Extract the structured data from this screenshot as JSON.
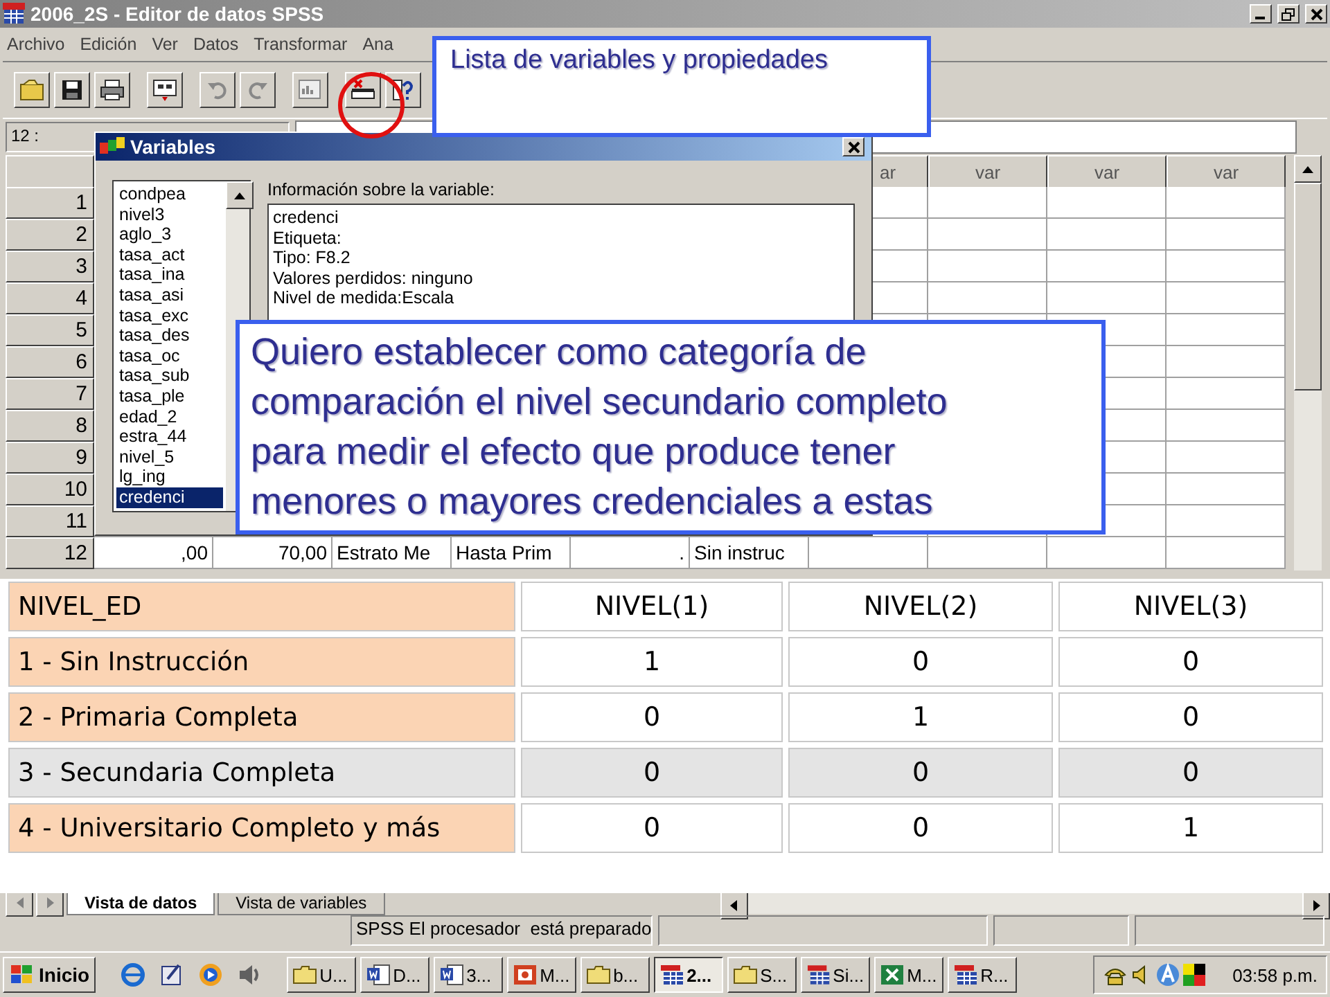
{
  "window": {
    "title": "2006_2S - Editor de datos SPSS"
  },
  "menu": [
    "Archivo",
    "Edición",
    "Ver",
    "Datos",
    "Transformar",
    "Ana"
  ],
  "cell_ref": {
    "label": "12 :"
  },
  "grid": {
    "column_headers": [
      "ar",
      "var",
      "var",
      "var"
    ],
    "rows": [
      {
        "number": "1"
      },
      {
        "number": "2"
      },
      {
        "number": "3"
      },
      {
        "number": "4"
      },
      {
        "number": "5"
      },
      {
        "number": "6"
      },
      {
        "number": "7"
      },
      {
        "number": "8"
      },
      {
        "number": "9"
      },
      {
        "number": "10"
      },
      {
        "number": "11"
      },
      {
        "number": "12",
        "cells": [
          ",00",
          "70,00",
          "Estrato Me",
          "Hasta Prim",
          ".",
          "Sin instruc"
        ]
      }
    ]
  },
  "dialog": {
    "title": "Variables",
    "info_label": "Información sobre la variable:",
    "variables": [
      {
        "name": "condpea",
        "selected": false
      },
      {
        "name": "nivel3",
        "selected": false
      },
      {
        "name": "aglo_3",
        "selected": false
      },
      {
        "name": "tasa_act",
        "selected": false
      },
      {
        "name": "tasa_ina",
        "selected": false
      },
      {
        "name": "tasa_asi",
        "selected": false
      },
      {
        "name": "tasa_exc",
        "selected": false
      },
      {
        "name": "tasa_des",
        "selected": false
      },
      {
        "name": "tasa_oc",
        "selected": false
      },
      {
        "name": "tasa_sub",
        "selected": false
      },
      {
        "name": "tasa_ple",
        "selected": false
      },
      {
        "name": "edad_2",
        "selected": false
      },
      {
        "name": "estra_44",
        "selected": false
      },
      {
        "name": "nivel_5",
        "selected": false
      },
      {
        "name": "lg_ing",
        "selected": false
      },
      {
        "name": "credenci",
        "selected": true
      }
    ],
    "info_lines": [
      "credenci",
      "Etiqueta:",
      "Tipo: F8.2",
      "Valores perdidos: ninguno",
      "Nivel de medida:Escala"
    ]
  },
  "callout_top": {
    "text": "Lista de variables y propiedades"
  },
  "callout_main": {
    "lines": [
      "Quiero establecer como categoría de",
      "comparación el nivel secundario completo",
      "para medir el efecto que produce tener",
      "menores o mayores credenciales a estas"
    ]
  },
  "coding_table": {
    "header": [
      "NIVEL_ED",
      "NIVEL(1)",
      "NIVEL(2)",
      "NIVEL(3)"
    ],
    "rows": [
      {
        "label": "1 - Sin Instrucción",
        "values": [
          "1",
          "0",
          "0"
        ],
        "highlighted": false
      },
      {
        "label": "2 - Primaria Completa",
        "values": [
          "0",
          "1",
          "0"
        ],
        "highlighted": false
      },
      {
        "label": "3 - Secundaria Completa",
        "values": [
          "0",
          "0",
          "0"
        ],
        "highlighted": true
      },
      {
        "label": "4 - Universitario Completo y más",
        "values": [
          "0",
          "0",
          "1"
        ],
        "highlighted": false
      }
    ]
  },
  "sheet_tabs": [
    {
      "label": "Vista de datos",
      "selected": true
    },
    {
      "label": "Vista de variables",
      "selected": false
    }
  ],
  "status_bar": {
    "text": "SPSS El procesador  está preparado"
  },
  "taskbar": {
    "start": "Inicio",
    "tasks": [
      {
        "label": "U...",
        "kind": "folder",
        "selected": false
      },
      {
        "label": "D...",
        "kind": "word",
        "selected": false
      },
      {
        "label": "3...",
        "kind": "word",
        "selected": false
      },
      {
        "label": "M...",
        "kind": "powerpoint",
        "selected": false
      },
      {
        "label": "b...",
        "kind": "folder",
        "selected": false
      },
      {
        "label": "2...",
        "kind": "spss",
        "selected": true
      },
      {
        "label": "S...",
        "kind": "folder",
        "selected": false
      },
      {
        "label": "Si...",
        "kind": "spss",
        "selected": false
      },
      {
        "label": "M...",
        "kind": "excel",
        "selected": false
      },
      {
        "label": "R...",
        "kind": "spss",
        "selected": false
      }
    ],
    "clock": "03:58 p.m."
  }
}
